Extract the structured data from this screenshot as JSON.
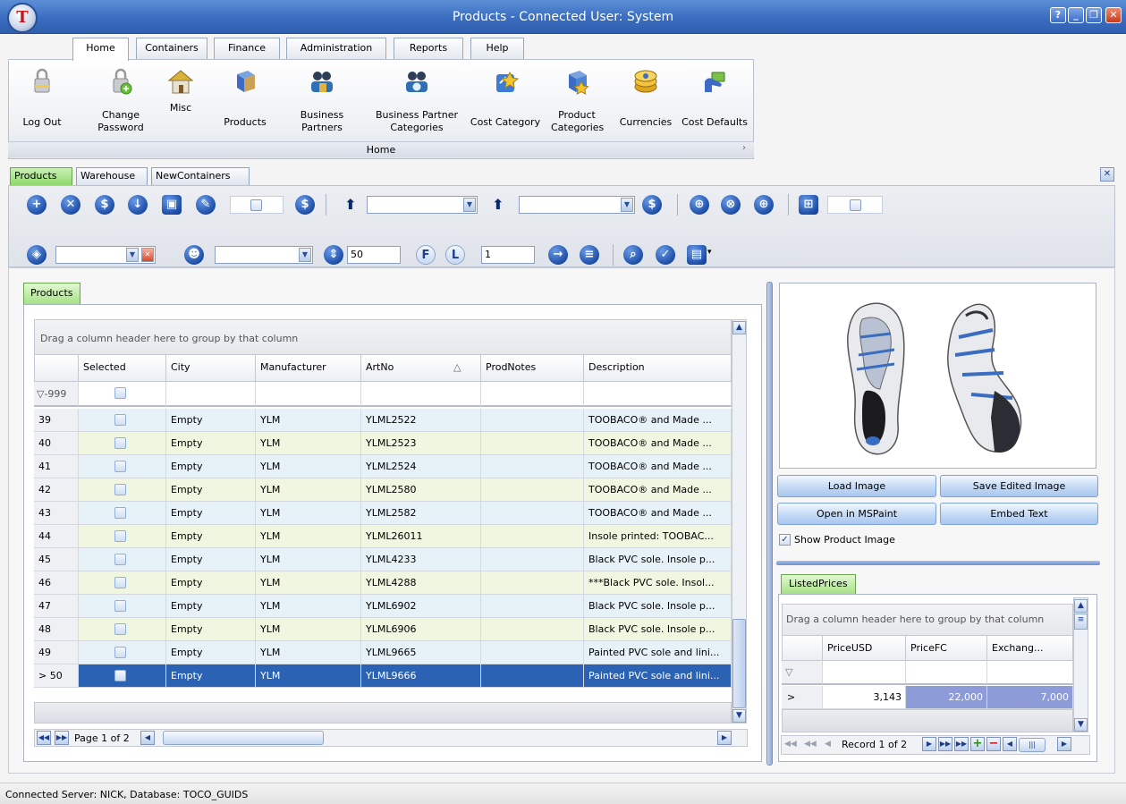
{
  "window": {
    "title": "Products - Connected User: System",
    "logo_text": "T"
  },
  "ribbon": {
    "tabs": [
      "Home",
      "Containers",
      "Finance",
      "Administration",
      "Reports",
      "Help"
    ],
    "active_tab": "Home",
    "group_label": "Home",
    "buttons": [
      {
        "label": "Log Out",
        "icon": "lock-icon"
      },
      {
        "label": "Change\nPassword",
        "icon": "lock-change-icon"
      },
      {
        "label": "Misc",
        "icon": "house-icon"
      },
      {
        "label": "Products",
        "icon": "products-icon"
      },
      {
        "label": "Business\nPartners",
        "icon": "partners-icon"
      },
      {
        "label": "Business Partner\nCategories",
        "icon": "partner-categories-icon"
      },
      {
        "label": "Cost Category",
        "icon": "cost-category-icon"
      },
      {
        "label": "Product\nCategories",
        "icon": "product-categories-icon"
      },
      {
        "label": "Currencies",
        "icon": "currencies-icon"
      },
      {
        "label": "Cost Defaults",
        "icon": "cost-defaults-icon"
      }
    ]
  },
  "doc_tabs": [
    "Products",
    "Warehouse",
    "NewContainers"
  ],
  "toolbar": {
    "page_size": "50",
    "page_number": "1"
  },
  "products_grid": {
    "tab_label": "Products",
    "group_hint": "Drag a column header here to group by that column",
    "columns": [
      "Selected",
      "City",
      "Manufacturer",
      "ArtNo",
      "ProdNotes",
      "Description"
    ],
    "sort_indicator": "△",
    "filter_row_label": "▽-999",
    "rows": [
      {
        "n": "39",
        "city": "Empty",
        "mfr": "YLM",
        "artno": "YLML2522",
        "desc": "TOOBACO® and Made ..."
      },
      {
        "n": "40",
        "city": "Empty",
        "mfr": "YLM",
        "artno": "YLML2523",
        "desc": "TOOBACO® and Made ..."
      },
      {
        "n": "41",
        "city": "Empty",
        "mfr": "YLM",
        "artno": "YLML2524",
        "desc": "TOOBACO® and Made ..."
      },
      {
        "n": "42",
        "city": "Empty",
        "mfr": "YLM",
        "artno": "YLML2580",
        "desc": "TOOBACO® and Made ..."
      },
      {
        "n": "43",
        "city": "Empty",
        "mfr": "YLM",
        "artno": "YLML2582",
        "desc": "TOOBACO® and Made ..."
      },
      {
        "n": "44",
        "city": "Empty",
        "mfr": "YLM",
        "artno": "YLML26011",
        "desc": "Insole printed: TOOBAC..."
      },
      {
        "n": "45",
        "city": "Empty",
        "mfr": "YLM",
        "artno": "YLML4233",
        "desc": "Black PVC sole. Insole p..."
      },
      {
        "n": "46",
        "city": "Empty",
        "mfr": "YLM",
        "artno": "YLML4288",
        "desc": "***Black PVC sole. Insol..."
      },
      {
        "n": "47",
        "city": "Empty",
        "mfr": "YLM",
        "artno": "YLML6902",
        "desc": "Black PVC sole. Insole p..."
      },
      {
        "n": "48",
        "city": "Empty",
        "mfr": "YLM",
        "artno": "YLML6906",
        "desc": "Black PVC sole. Insole p..."
      },
      {
        "n": "49",
        "city": "Empty",
        "mfr": "YLM",
        "artno": "YLML9665",
        "desc": "Painted PVC sole and lini..."
      },
      {
        "n": "> 50",
        "city": "Empty",
        "mfr": "YLM",
        "artno": "YLML9666",
        "desc": "Painted PVC sole and lini..."
      }
    ],
    "pager_text": "Page 1 of 2"
  },
  "image_panel": {
    "buttons": [
      "Load Image",
      "Save Edited Image",
      "Open in MSPaint",
      "Embed Text"
    ],
    "show_image_label": "Show Product Image"
  },
  "listed_prices": {
    "tab_label": "ListedPrices",
    "group_hint": "Drag a column header here to group by that column",
    "columns": [
      "PriceUSD",
      "PriceFC",
      "Exchang..."
    ],
    "row": {
      "marker": ">",
      "usd": "3,143",
      "fc": "22,000",
      "exch": "7,000"
    },
    "pager_text": "Record 1 of 2"
  },
  "status": {
    "text": "Connected Server: NICK, Database: TOCO_GUIDS"
  },
  "colors": {
    "accent": "#2c62b4",
    "tab_green": "#a6e284",
    "title_blue": "#3a6cbf"
  }
}
